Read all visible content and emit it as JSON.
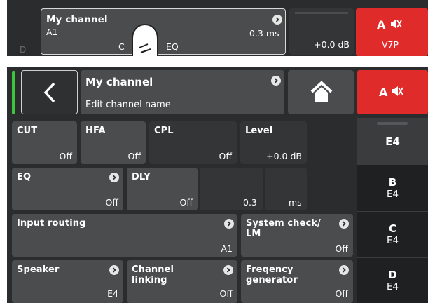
{
  "top": {
    "channel_title": "My channel",
    "channel_sub": "A1",
    "channel_value": "0.3 ms",
    "hidden_labels": [
      "C",
      "EQ"
    ],
    "level_value": "+0.0 dB",
    "amp_label": "A",
    "amp_sub": "V7P",
    "cut_letter": "D"
  },
  "header": {
    "title": "My channel",
    "subtitle": "Edit channel name",
    "amp_label": "A"
  },
  "tiles": {
    "cut": {
      "label": "CUT",
      "value": "Off"
    },
    "hfa": {
      "label": "HFA",
      "value": "Off"
    },
    "cpl": {
      "label": "CPL",
      "value": "Off"
    },
    "level": {
      "label": "Level",
      "value": "+0.0 dB"
    },
    "eq": {
      "label": "EQ",
      "value": "Off"
    },
    "dly": {
      "label": "DLY",
      "value": "Off"
    },
    "dly_value": "0.3",
    "dly_unit": "ms",
    "input_routing": {
      "label": "Input routing",
      "value": "A1"
    },
    "system_check": {
      "label1": "System check/",
      "label2": "LM",
      "value": "Off"
    },
    "speaker": {
      "label": "Speaker",
      "value": "E4"
    },
    "channel_linking": {
      "label1": "Channel",
      "label2": "linking",
      "value": "Off"
    },
    "freq_gen": {
      "label1": "Freqency",
      "label2": "generator",
      "value": "Off"
    }
  },
  "side": [
    {
      "big": "",
      "small": "E4"
    },
    {
      "big": "B",
      "small": "E4"
    },
    {
      "big": "C",
      "small": "E4"
    },
    {
      "big": "D",
      "small": "E4"
    }
  ],
  "colors": {
    "accent_green": "#3cc53c",
    "mute_red": "#e02b2b"
  },
  "icons": [
    "finger-tap-icon",
    "chevron-right-icon",
    "back-arrow-icon",
    "home-icon",
    "mute-speaker-icon"
  ]
}
